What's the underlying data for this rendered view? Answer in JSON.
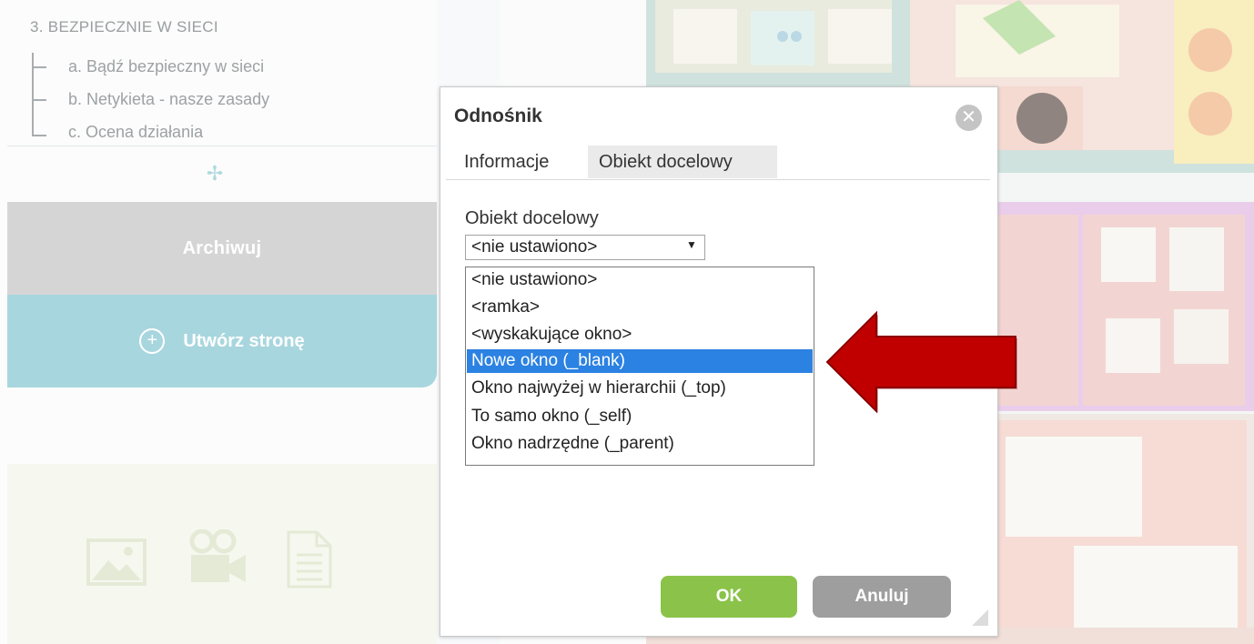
{
  "sidebar": {
    "section_title": "3. BEZPIECZNIE W SIECI",
    "sub_items": [
      "a. Bądź bezpieczny w sieci",
      "b. Netykieta - nasze zasady",
      "c. Ocena działania"
    ],
    "archive_label": "Archiwuj",
    "create_page_label": "Utwórz stronę",
    "media_icons": [
      "image-icon",
      "video-camera-icon",
      "document-icon"
    ]
  },
  "dialog": {
    "title": "Odnośnik",
    "tabs": [
      "Informacje",
      "Obiekt docelowy"
    ],
    "active_tab": "Obiekt docelowy",
    "field_label": "Obiekt docelowy",
    "select_value": "<nie ustawiono>",
    "options": [
      "<nie ustawiono>",
      "<ramka>",
      "<wyskakujące okno>",
      "Nowe okno (_blank)",
      "Okno najwyżej w hierarchii (_top)",
      "To samo okno (_self)",
      "Okno nadrzędne (_parent)"
    ],
    "highlighted_option": "Nowe okno (_blank)",
    "ok_label": "OK",
    "cancel_label": "Anuluj"
  },
  "colors": {
    "accent_teal": "#a8d6de",
    "archive_gray": "#d5d5d5",
    "ok_green": "#8bc34a",
    "cancel_gray": "#9e9e9e",
    "selection_blue": "#2b82e2",
    "arrow_red": "#c00000"
  }
}
